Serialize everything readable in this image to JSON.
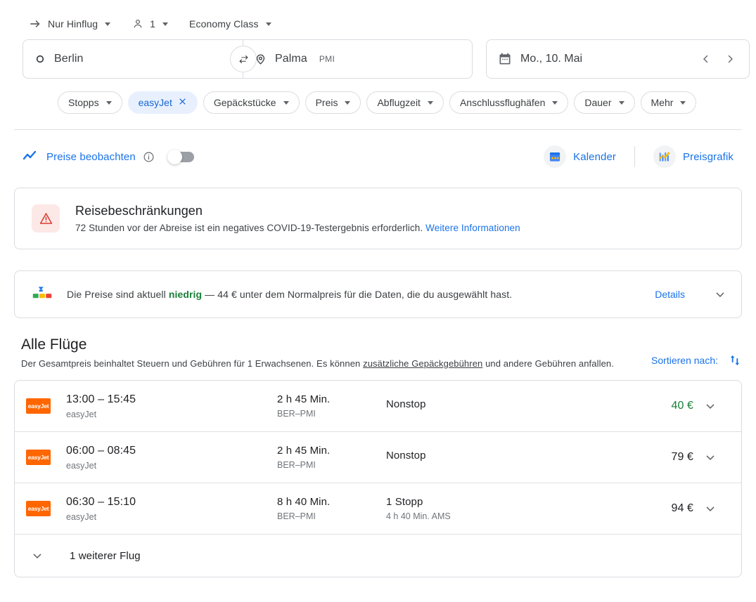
{
  "controls": {
    "trip_type": "Nur Hinflug",
    "passengers": "1",
    "cabin_class": "Economy Class"
  },
  "search": {
    "origin": "Berlin",
    "destination": "Palma",
    "destination_code": "PMI",
    "date": "Mo., 10. Mai"
  },
  "filters": [
    {
      "label": "Stopps",
      "active": false
    },
    {
      "label": "easyJet",
      "active": true
    },
    {
      "label": "Gepäckstücke",
      "active": false
    },
    {
      "label": "Preis",
      "active": false
    },
    {
      "label": "Abflugzeit",
      "active": false
    },
    {
      "label": "Anschlussflughäfen",
      "active": false
    },
    {
      "label": "Dauer",
      "active": false
    },
    {
      "label": "Mehr",
      "active": false
    }
  ],
  "watch": {
    "label": "Preise beobachten",
    "toggle_state": "off"
  },
  "views": {
    "calendar": "Kalender",
    "price_graph": "Preisgrafik"
  },
  "restrictions": {
    "title": "Reisebeschränkungen",
    "description": "72 Stunden vor der Abreise ist ein negatives COVID-19-Testergebnis erforderlich.",
    "link": "Weitere Informationen"
  },
  "price_insight": {
    "text_before": "Die Preise sind aktuell ",
    "highlight": "niedrig",
    "text_after": " — 44 € unter dem Normalpreis für die Daten, die du ausgewählt hast.",
    "details_label": "Details"
  },
  "flights_section": {
    "title": "Alle Flüge",
    "subtitle_before": "Der Gesamtpreis beinhaltet Steuern und Gebühren für 1 Erwachsenen. Es können ",
    "subtitle_link": "zusätzliche Gepäckgebühren",
    "subtitle_after": " und andere Gebühren anfallen.",
    "sort_label": "Sortieren nach:"
  },
  "flights": [
    {
      "airline": "easyJet",
      "logo_text": "easyJet",
      "times": "13:00 – 15:45",
      "duration": "2 h 45 Min.",
      "route": "BER–PMI",
      "stops": "Nonstop",
      "stop_detail": "",
      "price": "40 €",
      "price_is_low": true
    },
    {
      "airline": "easyJet",
      "logo_text": "easyJet",
      "times": "06:00 – 08:45",
      "duration": "2 h 45 Min.",
      "route": "BER–PMI",
      "stops": "Nonstop",
      "stop_detail": "",
      "price": "79 €",
      "price_is_low": false
    },
    {
      "airline": "easyJet",
      "logo_text": "easyJet",
      "times": "06:30 – 15:10",
      "duration": "8 h 40 Min.",
      "route": "BER–PMI",
      "stops": "1 Stopp",
      "stop_detail": "4 h 40 Min. AMS",
      "price": "94 €",
      "price_is_low": false
    }
  ],
  "more_flights": {
    "label": "1 weiterer Flug"
  },
  "colors": {
    "blue": "#1a73e8",
    "green": "#188038",
    "orange": "#ff6600",
    "text": "#3c4043"
  }
}
